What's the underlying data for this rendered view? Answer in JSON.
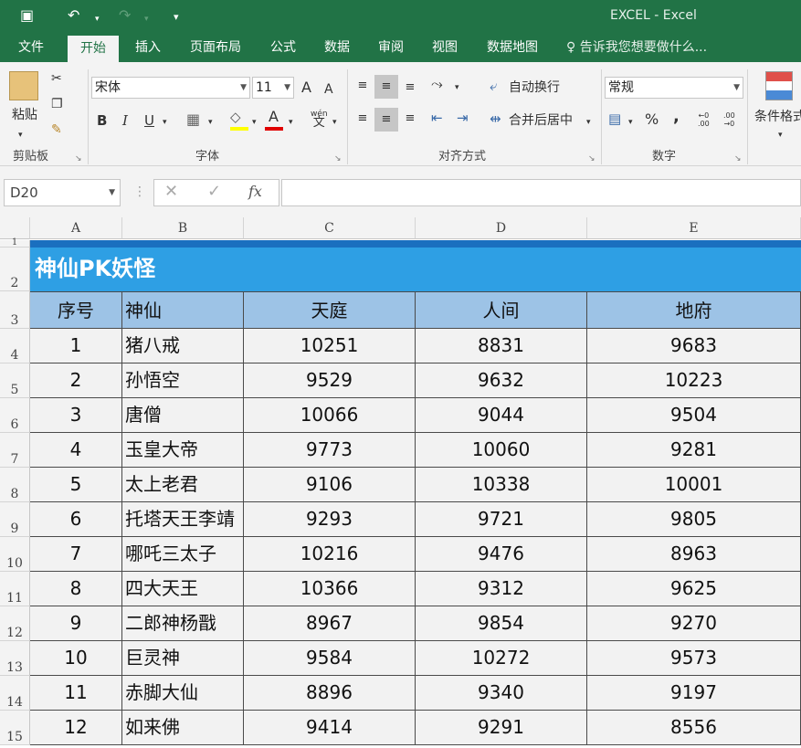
{
  "app": {
    "title": "EXCEL - Excel"
  },
  "ribbon_tabs": [
    "文件",
    "开始",
    "插入",
    "页面布局",
    "公式",
    "数据",
    "审阅",
    "视图",
    "数据地图"
  ],
  "tell_me": "告诉我您想要做什么...",
  "ribbon": {
    "paste_label": "粘贴",
    "clipboard_label": "剪贴板",
    "font_name": "宋体",
    "font_size": "11",
    "font_group_label": "字体",
    "wrap_text": "自动换行",
    "merge_center": "合并后居中",
    "align_group_label": "对齐方式",
    "number_format": "常规",
    "number_group_label": "数字",
    "conditional_format": "条件格式",
    "bold": "B",
    "italic": "I",
    "underline": "U",
    "font_a_grow": "A",
    "font_a_shrink": "A",
    "font_color_a": "A",
    "percent": "%",
    "comma": ",",
    "fx": "fx",
    "wen": "wén"
  },
  "formula_bar": {
    "name_box": "D20",
    "formula": ""
  },
  "sheet": {
    "columns": [
      "A",
      "B",
      "C",
      "D",
      "E"
    ],
    "banner_title": "神仙PK妖怪",
    "headers": [
      "序号",
      "神仙",
      "天庭",
      "人间",
      "地府"
    ],
    "row_numbers": [
      "1",
      "2",
      "3",
      "4",
      "5",
      "6",
      "7",
      "8",
      "9",
      "10",
      "11",
      "12",
      "13",
      "14",
      "15"
    ],
    "rows": [
      [
        "1",
        "猪八戒",
        "10251",
        "8831",
        "9683"
      ],
      [
        "2",
        "孙悟空",
        "9529",
        "9632",
        "10223"
      ],
      [
        "3",
        "唐僧",
        "10066",
        "9044",
        "9504"
      ],
      [
        "4",
        "玉皇大帝",
        "9773",
        "10060",
        "9281"
      ],
      [
        "5",
        "太上老君",
        "9106",
        "10338",
        "10001"
      ],
      [
        "6",
        "托塔天王李靖",
        "9293",
        "9721",
        "9805"
      ],
      [
        "7",
        "哪吒三太子",
        "10216",
        "9476",
        "8963"
      ],
      [
        "8",
        "四大天王",
        "10366",
        "9312",
        "9625"
      ],
      [
        "9",
        "二郎神杨戬",
        "8967",
        "9854",
        "9270"
      ],
      [
        "10",
        "巨灵神",
        "9584",
        "10272",
        "9573"
      ],
      [
        "11",
        "赤脚大仙",
        "8896",
        "9340",
        "9197"
      ],
      [
        "12",
        "如来佛",
        "9414",
        "9291",
        "8556"
      ]
    ]
  },
  "colors": {
    "excel_green": "#217346",
    "banner_blue": "#2e9fe4",
    "header_blue": "#9dc3e6"
  }
}
